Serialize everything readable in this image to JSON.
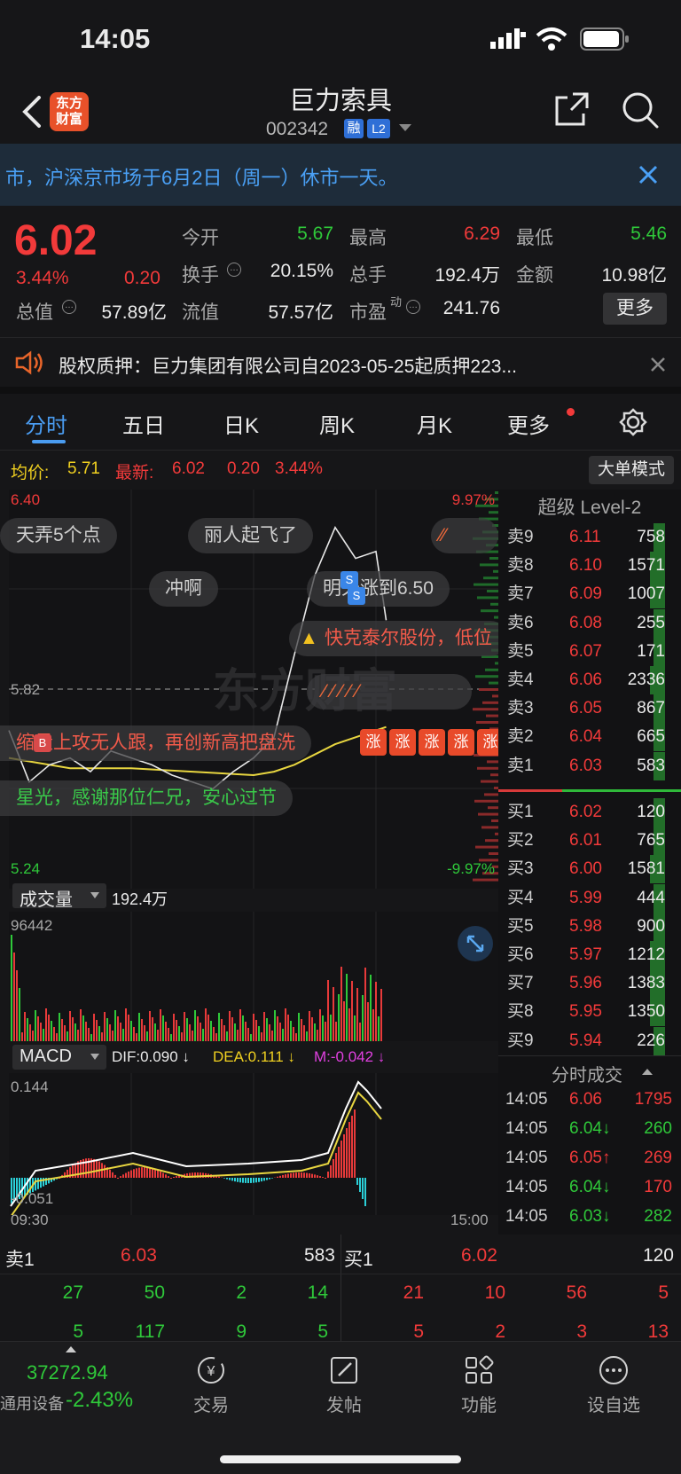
{
  "status": {
    "time": "14:05"
  },
  "nav": {
    "title": "巨力索具",
    "code": "002342",
    "badge_rong": "融",
    "badge_l2": "L2",
    "logo_line1": "东方",
    "logo_line2": "财富"
  },
  "notice": {
    "text": "市，沪深京市场于6月2日（周一）休市一天。"
  },
  "quote": {
    "price": "6.02",
    "pct": "3.44%",
    "chg": "0.20",
    "open_label": "今开",
    "open": "5.67",
    "high_label": "最高",
    "high": "6.29",
    "low_label": "最低",
    "low": "5.46",
    "turnover_label": "换手",
    "turnover": "20.15%",
    "volume_label": "总手",
    "volume": "192.4万",
    "amount_label": "金额",
    "amount": "10.98亿",
    "mktcap_label": "总值",
    "mktcap": "57.89亿",
    "float_label": "流值",
    "float": "57.57亿",
    "pe_label": "市盈",
    "pe_sup": "动",
    "pe": "241.76",
    "more": "更多"
  },
  "news": {
    "text": "股权质押：巨力集团有限公司自2023-05-25起质押223..."
  },
  "tabs": {
    "items": [
      "分时",
      "五日",
      "日K",
      "周K",
      "月K",
      "更多"
    ]
  },
  "chart": {
    "avg_label": "均价:",
    "avg": "5.71",
    "latest_label": "最新:",
    "latest": "6.02",
    "latest_chg": "0.20",
    "latest_pct": "3.44%",
    "big_order": "大单模式",
    "y_top": "6.40",
    "y_mid": "5.82",
    "y_bot": "5.24",
    "pct_top": "9.97%",
    "pct_bot": "-9.97%",
    "watermark": "东方财富",
    "comments": [
      "天弄5个点",
      "丽人起飞了",
      "冲啊",
      "明天涨到6.50",
      "快克泰尔股份，低位",
      "缩量上攻无人跟，再创新高把盘洗",
      "星光，感谢那位仁兄，安心过节"
    ],
    "zhang": "涨",
    "badge_b": "B",
    "badge_s": "S",
    "vol_label": "成交量",
    "vol_value": "192.4万",
    "vol_max": "96442",
    "macd_label": "MACD",
    "dif": "DIF:0.090 ↓",
    "dea": "DEA:0.111 ↓",
    "m": "M:-0.042 ↓",
    "macd_top": "0.144",
    "macd_bot": "-0.051",
    "t_start": "09:30",
    "t_end": "15:00"
  },
  "chart_data": {
    "type": "line",
    "title": "",
    "x_range": [
      "09:30",
      "15:00"
    ],
    "ylim": [
      5.24,
      6.4
    ],
    "prev_close": 5.82,
    "series": [
      {
        "name": "最新",
        "x": [
          "09:30",
          "09:40",
          "09:50",
          "10:00",
          "10:10",
          "10:20",
          "10:30",
          "10:40",
          "10:50",
          "11:00",
          "11:10",
          "11:20",
          "11:30",
          "13:10",
          "13:20",
          "13:30",
          "13:40",
          "13:50",
          "14:00",
          "14:05"
        ],
        "values": [
          5.7,
          5.55,
          5.6,
          5.62,
          5.58,
          5.64,
          5.62,
          5.6,
          5.57,
          5.55,
          5.53,
          5.58,
          5.62,
          5.68,
          5.92,
          6.15,
          6.29,
          6.2,
          6.22,
          6.02
        ]
      },
      {
        "name": "均价",
        "x": [
          "09:30",
          "10:00",
          "10:30",
          "11:00",
          "11:30",
          "13:10",
          "13:20",
          "13:30",
          "13:40",
          "13:50",
          "14:00",
          "14:05"
        ],
        "values": [
          5.62,
          5.59,
          5.59,
          5.58,
          5.57,
          5.58,
          5.6,
          5.63,
          5.66,
          5.68,
          5.7,
          5.71
        ]
      }
    ]
  },
  "orderbook": {
    "title": "超级 Level-2",
    "sells": [
      {
        "label": "卖9",
        "price": "6.11",
        "vol": "758"
      },
      {
        "label": "卖8",
        "price": "6.10",
        "vol": "1571"
      },
      {
        "label": "卖7",
        "price": "6.09",
        "vol": "1007"
      },
      {
        "label": "卖6",
        "price": "6.08",
        "vol": "255"
      },
      {
        "label": "卖5",
        "price": "6.07",
        "vol": "171"
      },
      {
        "label": "卖4",
        "price": "6.06",
        "vol": "2336"
      },
      {
        "label": "卖3",
        "price": "6.05",
        "vol": "867"
      },
      {
        "label": "卖2",
        "price": "6.04",
        "vol": "665"
      },
      {
        "label": "卖1",
        "price": "6.03",
        "vol": "583"
      }
    ],
    "buys": [
      {
        "label": "买1",
        "price": "6.02",
        "vol": "120"
      },
      {
        "label": "买2",
        "price": "6.01",
        "vol": "765"
      },
      {
        "label": "买3",
        "price": "6.00",
        "vol": "1581"
      },
      {
        "label": "买4",
        "price": "5.99",
        "vol": "444"
      },
      {
        "label": "买5",
        "price": "5.98",
        "vol": "900"
      },
      {
        "label": "买6",
        "price": "5.97",
        "vol": "1212"
      },
      {
        "label": "买7",
        "price": "5.96",
        "vol": "1383"
      },
      {
        "label": "买8",
        "price": "5.95",
        "vol": "1350"
      },
      {
        "label": "买9",
        "price": "5.94",
        "vol": "226"
      }
    ],
    "trades_title": "分时成交",
    "trades": [
      {
        "time": "14:05",
        "price": "6.06",
        "vol": "1795"
      },
      {
        "time": "14:05",
        "price": "6.04↓",
        "vol": "260"
      },
      {
        "time": "14:05",
        "price": "6.05↑",
        "vol": "269"
      },
      {
        "time": "14:05",
        "price": "6.04↓",
        "vol": "170"
      },
      {
        "time": "14:05",
        "price": "6.03↓",
        "vol": "282"
      }
    ]
  },
  "level1": {
    "sell_label": "卖1",
    "sell_price": "6.03",
    "sell_vol": "583",
    "buy_label": "买1",
    "buy_price": "6.02",
    "buy_vol": "120",
    "sell_split_1": [
      "27",
      "50",
      "2",
      "14"
    ],
    "buy_split_1": [
      "21",
      "10",
      "56",
      "5"
    ],
    "sell_split_2": [
      "5",
      "117",
      "9",
      "5"
    ],
    "buy_split_2": [
      "5",
      "2",
      "3",
      "13"
    ]
  },
  "tabbar": {
    "index_value": "37272.94",
    "index_name": "通用设备",
    "index_pct": "-2.43%",
    "items": [
      "交易",
      "发帖",
      "功能",
      "设自选"
    ]
  }
}
